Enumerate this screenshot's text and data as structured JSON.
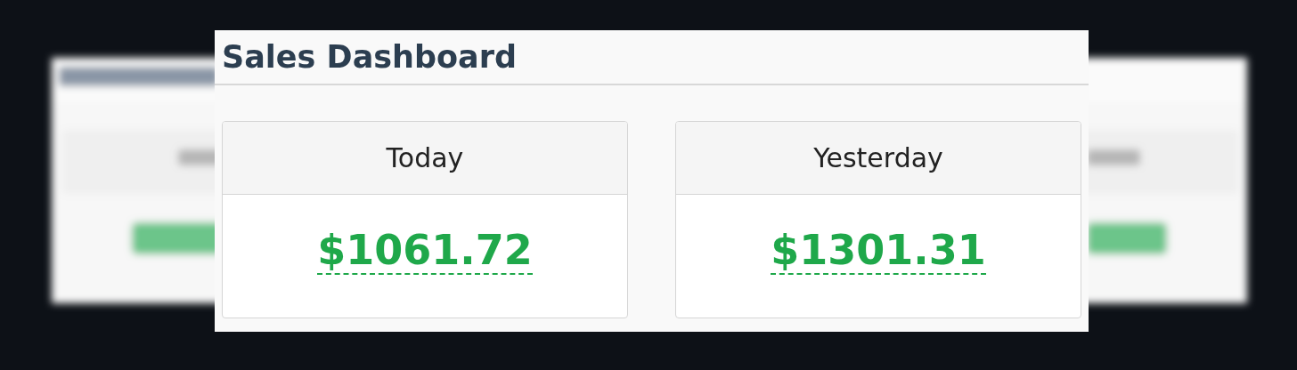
{
  "dashboard": {
    "title": "Sales Dashboard",
    "cards": [
      {
        "label": "Today",
        "value": "$1061.72"
      },
      {
        "label": "Yesterday",
        "value": "$1301.31"
      }
    ]
  }
}
